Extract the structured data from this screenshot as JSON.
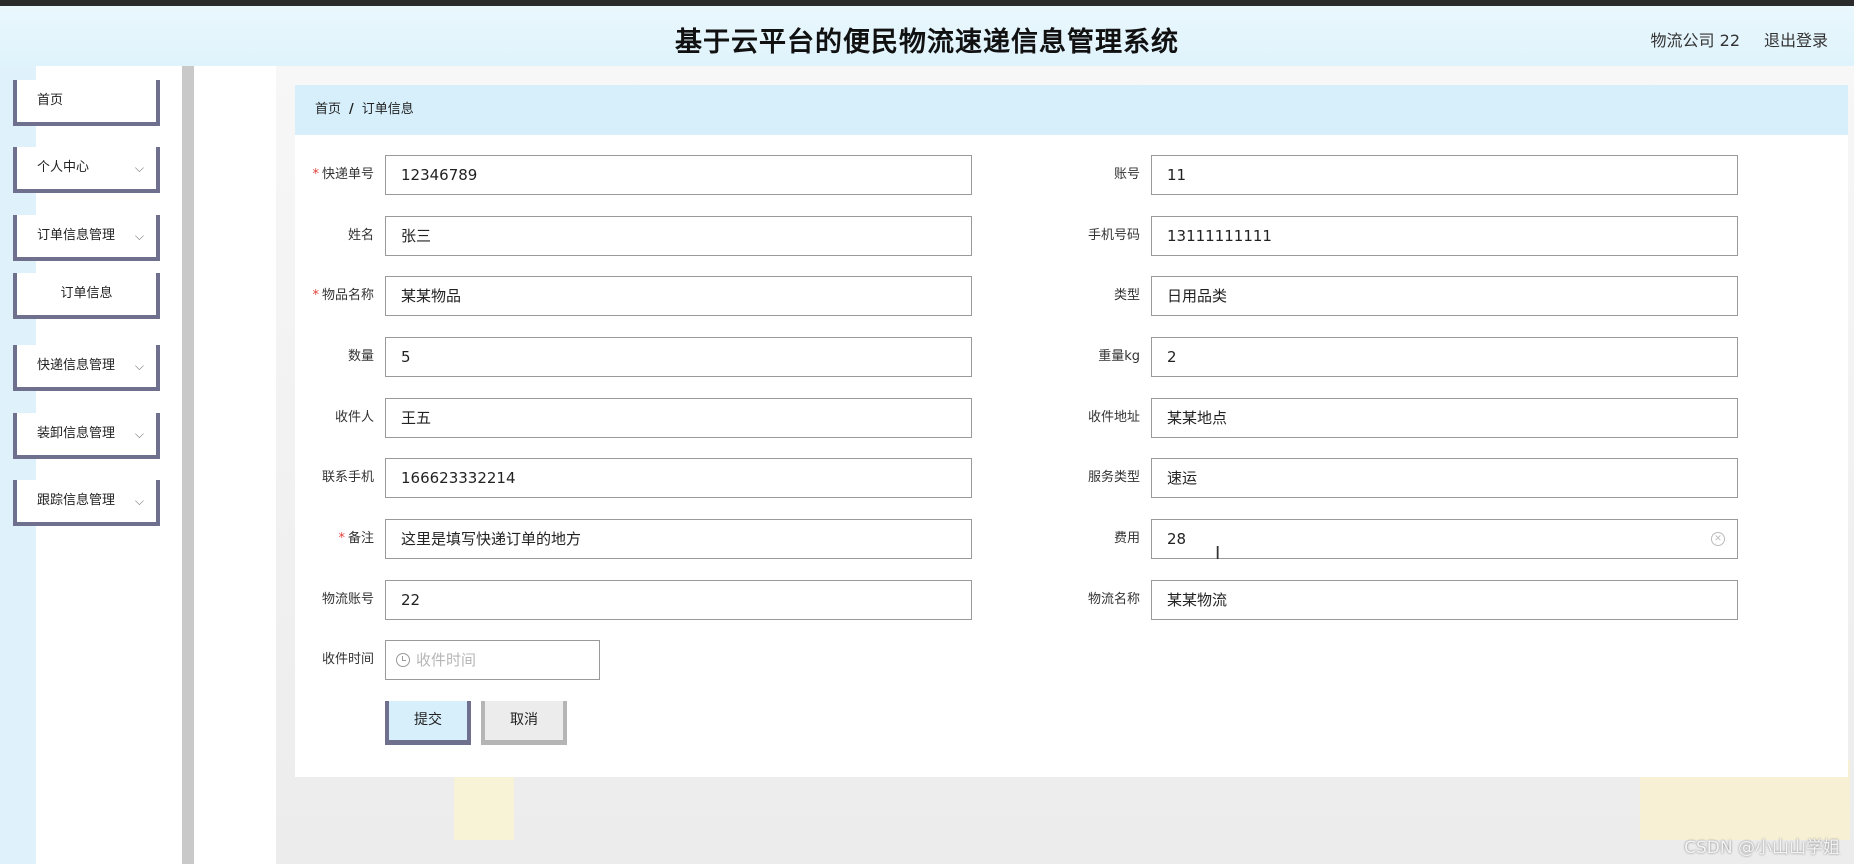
{
  "header": {
    "title": "基于云平台的便民物流速递信息管理系统",
    "user": "物流公司 22",
    "logout": "退出登录"
  },
  "sidebar": {
    "items": [
      {
        "label": "首页"
      },
      {
        "label": "个人中心"
      },
      {
        "label": "订单信息管理"
      },
      {
        "label": "订单信息"
      },
      {
        "label": "快递信息管理"
      },
      {
        "label": "装卸信息管理"
      },
      {
        "label": "跟踪信息管理"
      }
    ]
  },
  "breadcrumb": {
    "home": "首页",
    "sep": "/",
    "current": "订单信息"
  },
  "form": {
    "express_no": {
      "label": "快递单号",
      "value": "12346789"
    },
    "account": {
      "label": "账号",
      "value": "11"
    },
    "name": {
      "label": "姓名",
      "value": "张三"
    },
    "phone": {
      "label": "手机号码",
      "value": "13111111111"
    },
    "item_name": {
      "label": "物品名称",
      "value": "某某物品"
    },
    "type": {
      "label": "类型",
      "value": "日用品类"
    },
    "quantity": {
      "label": "数量",
      "value": "5"
    },
    "weight": {
      "label": "重量kg",
      "value": "2"
    },
    "receiver": {
      "label": "收件人",
      "value": "王五"
    },
    "address": {
      "label": "收件地址",
      "value": "某某地点"
    },
    "contact_phone": {
      "label": "联系手机",
      "value": "166623332214"
    },
    "service_type": {
      "label": "服务类型",
      "value": "速运"
    },
    "remark": {
      "label": "备注",
      "value": "这里是填写快递订单的地方"
    },
    "fee": {
      "label": "费用",
      "value": "28"
    },
    "logistics_account": {
      "label": "物流账号",
      "value": "22"
    },
    "logistics_name": {
      "label": "物流名称",
      "value": "某某物流"
    },
    "receive_time": {
      "label": "收件时间",
      "placeholder": "收件时间"
    },
    "required_mark": "*"
  },
  "buttons": {
    "submit": "提交",
    "cancel": "取消"
  },
  "watermark": "CSDN @小山山学姐"
}
